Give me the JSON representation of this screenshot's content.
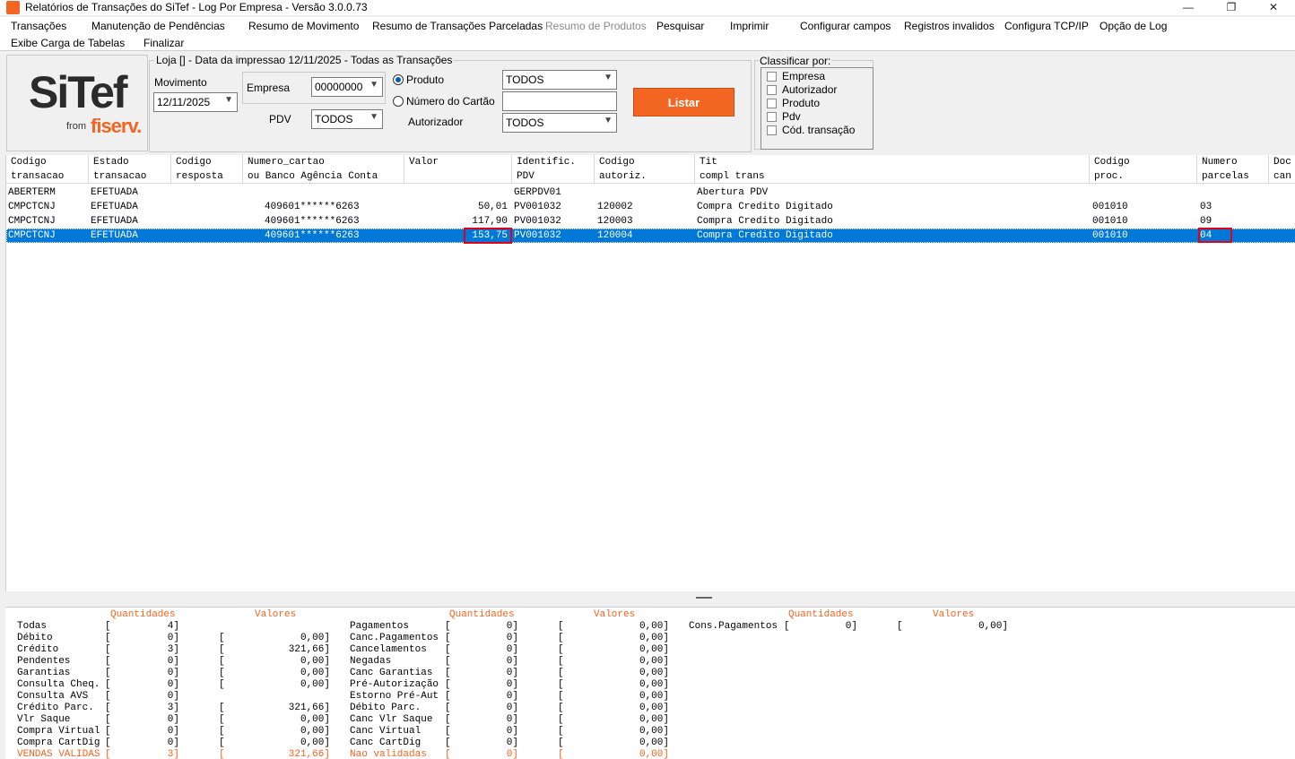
{
  "window": {
    "title": "Relatórios de Transações do SiTef - Log Por Empresa - Versão 3.0.0.73",
    "btn_min": "—",
    "btn_max": "❐",
    "btn_close": "✕"
  },
  "menu": {
    "row1": [
      "Transações",
      "Manutenção de Pendências",
      "Resumo de Movimento",
      "Resumo de Transações Parceladas",
      "Resumo de Produtos",
      "Pesquisar",
      "Imprimir",
      "Configurar campos",
      "Registros invalidos",
      "Configura TCP/IP",
      "Opção de Log"
    ],
    "row2": [
      "Exibe Carga de Tabelas",
      "Finalizar"
    ]
  },
  "logo": {
    "brand": "SiTef",
    "from": "from",
    "company": "fiserv."
  },
  "filters": {
    "group_label": "Loja [] - Data da impressao 12/11/2025 - Todas as Transações",
    "movimento_label": "Movimento",
    "movimento_value": "12/11/2025",
    "empresa_label": "Empresa",
    "empresa_value": "00000000",
    "pdv_label": "PDV",
    "pdv_value": "TODOS",
    "produto_radio": "Produto",
    "produto_value": "TODOS",
    "cartao_radio": "Número do Cartão",
    "cartao_value": "",
    "autorizador_label": "Autorizador",
    "autorizador_value": "TODOS",
    "listar": "Listar"
  },
  "classificar": {
    "label": "Classificar por:",
    "options": [
      "Empresa",
      "Autorizador",
      "Produto",
      "Pdv",
      "Cód. transação"
    ]
  },
  "grid": {
    "headers": [
      [
        "Codigo",
        "transacao"
      ],
      [
        "Estado",
        "transacao"
      ],
      [
        "Codigo",
        "resposta"
      ],
      [
        "Numero_cartao",
        "ou Banco Agência Conta"
      ],
      [
        "Valor",
        ""
      ],
      [
        "Identific.",
        "PDV"
      ],
      [
        "Codigo",
        "autoriz."
      ],
      [
        "Tit",
        "compl trans"
      ],
      [
        "Codigo",
        "proc."
      ],
      [
        "Numero",
        "parcelas"
      ],
      [
        "Doc",
        "can"
      ]
    ],
    "rows": [
      [
        "ABERTERM",
        "EFETUADA",
        "",
        "",
        "",
        "GERPDV01",
        "",
        "Abertura PDV",
        "",
        ""
      ],
      [
        "CMPCTCNJ",
        "EFETUADA",
        "",
        "409601******6263",
        "50,01",
        "PV001032",
        "120002",
        "Compra Credito Digitado",
        "001010",
        "03"
      ],
      [
        "CMPCTCNJ",
        "EFETUADA",
        "",
        "409601******6263",
        "117,90",
        "PV001032",
        "120003",
        "Compra Credito Digitado",
        "001010",
        "09"
      ],
      [
        "CMPCTCNJ",
        "EFETUADA",
        "",
        "409601******6263",
        "153,75",
        "PV001032",
        "120004",
        "Compra Credito Digitado",
        "001010",
        "04"
      ]
    ]
  },
  "totals": {
    "h_quant": "Quantidades",
    "h_val": "Valores",
    "col1": [
      {
        "label": "Todas",
        "qty": "4]",
        "val": ""
      },
      {
        "label": "Débito",
        "qty": "0]",
        "val": "0,00]"
      },
      {
        "label": "Crédito",
        "qty": "3]",
        "val": "321,66]"
      },
      {
        "label": "Pendentes",
        "qty": "0]",
        "val": "0,00]"
      },
      {
        "label": "Garantias",
        "qty": "0]",
        "val": "0,00]"
      },
      {
        "label": "Consulta Cheq.",
        "qty": "0]",
        "val": "0,00]"
      },
      {
        "label": "Consulta AVS",
        "qty": "0]",
        "val": ""
      },
      {
        "label": "Crédito Parc.",
        "qty": "3]",
        "val": "321,66]"
      },
      {
        "label": "Vlr Saque",
        "qty": "0]",
        "val": "0,00]"
      },
      {
        "label": "Compra Virtual",
        "qty": "0]",
        "val": "0,00]"
      },
      {
        "label": "Compra CartDig",
        "qty": "0]",
        "val": "0,00]"
      },
      {
        "label": "VENDAS VALIDAS",
        "qty": "3]",
        "val": "321,66]"
      }
    ],
    "col2": [
      {
        "label": "Pagamentos",
        "qty": "0]",
        "val": "0,00]"
      },
      {
        "label": "Canc.Pagamentos",
        "qty": "0]",
        "val": "0,00]"
      },
      {
        "label": "Cancelamentos",
        "qty": "0]",
        "val": "0,00]"
      },
      {
        "label": "Negadas",
        "qty": "0]",
        "val": "0,00]"
      },
      {
        "label": "Canc Garantias",
        "qty": "0]",
        "val": "0,00]"
      },
      {
        "label": "Pré-Autorização",
        "qty": "0]",
        "val": "0,00]"
      },
      {
        "label": "Estorno Pré-Aut",
        "qty": "0]",
        "val": "0,00]"
      },
      {
        "label": "Débito Parc.",
        "qty": "0]",
        "val": "0,00]"
      },
      {
        "label": "Canc Vlr Saque",
        "qty": "0]",
        "val": "0,00]"
      },
      {
        "label": "Canc Virtual",
        "qty": "0]",
        "val": "0,00]"
      },
      {
        "label": "Canc CartDig",
        "qty": "0]",
        "val": "0,00]"
      },
      {
        "label": "Nao validadas",
        "qty": "0]",
        "val": "0,00]"
      }
    ],
    "col3": [
      {
        "label": "Cons.Pagamentos",
        "qty": "0]",
        "val": "0,00]"
      }
    ]
  },
  "colors": {
    "accent": "#f26522",
    "selection": "#0078d7",
    "highlight": "#e0001a"
  }
}
